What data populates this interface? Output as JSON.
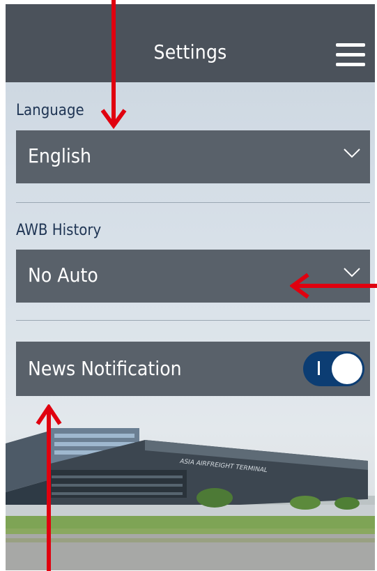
{
  "header": {
    "title": "Settings"
  },
  "icons": {
    "menu": "hamburger-menu-icon",
    "dropdown": "chevron-down-icon"
  },
  "language": {
    "label": "Language",
    "selected": "English"
  },
  "awb_history": {
    "label": "AWB History",
    "selected": "No Auto"
  },
  "news_notification": {
    "label": "News Notification",
    "enabled": true
  },
  "background": {
    "building_sign": "ASIA AIRFREIGHT TERMINAL"
  },
  "colors": {
    "header": "#4b525b",
    "field": "#59616a",
    "label_text": "#1f3554",
    "toggle_on": "#0c3d73",
    "annotation_arrow": "#e0000f"
  }
}
